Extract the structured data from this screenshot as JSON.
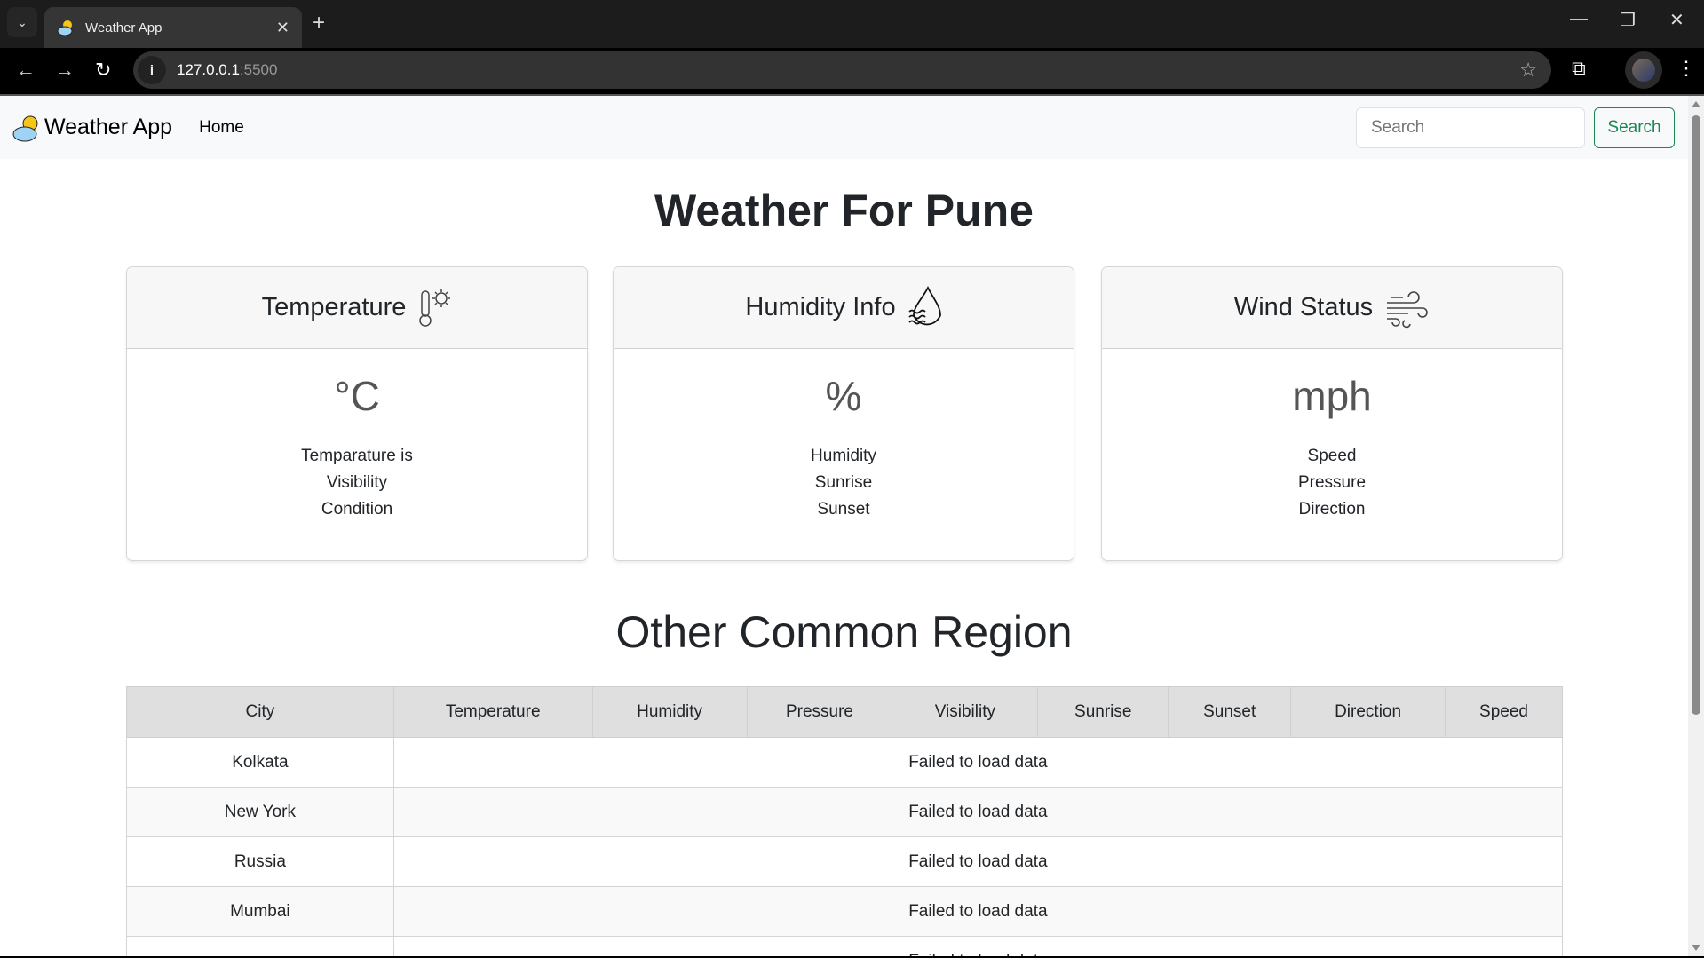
{
  "browser": {
    "tab_title": "Weather App",
    "url_host": "127.0.0.1",
    "url_port": ":5500"
  },
  "navbar": {
    "brand": "Weather App",
    "home": "Home",
    "search_placeholder": "Search",
    "search_button": "Search"
  },
  "main": {
    "title": "Weather For Pune",
    "cards": [
      {
        "title": "Temperature",
        "icon": "thermometer-sun-icon",
        "unit": "°C",
        "lines": [
          "Temparature is",
          "Visibility",
          "Condition"
        ]
      },
      {
        "title": "Humidity Info",
        "icon": "water-drop-icon",
        "unit": "%",
        "lines": [
          "Humidity",
          "Sunrise",
          "Sunset"
        ]
      },
      {
        "title": "Wind Status",
        "icon": "wind-icon",
        "unit": "mph",
        "lines": [
          "Speed",
          "Pressure",
          "Direction"
        ]
      }
    ],
    "region_title": "Other Common Region",
    "table": {
      "headers": [
        "City",
        "Temperature",
        "Humidity",
        "Pressure",
        "Visibility",
        "Sunrise",
        "Sunset",
        "Direction",
        "Speed"
      ],
      "rows": [
        {
          "city": "Kolkata",
          "message": "Failed to load data"
        },
        {
          "city": "New York",
          "message": "Failed to load data"
        },
        {
          "city": "Russia",
          "message": "Failed to load data"
        },
        {
          "city": "Mumbai",
          "message": "Failed to load data"
        },
        {
          "city": "",
          "message": "Failed to load data"
        }
      ]
    }
  },
  "colors": {
    "accent": "#198754",
    "navbar_bg": "#f8f9fa",
    "table_header_bg": "#dfdfdf"
  }
}
